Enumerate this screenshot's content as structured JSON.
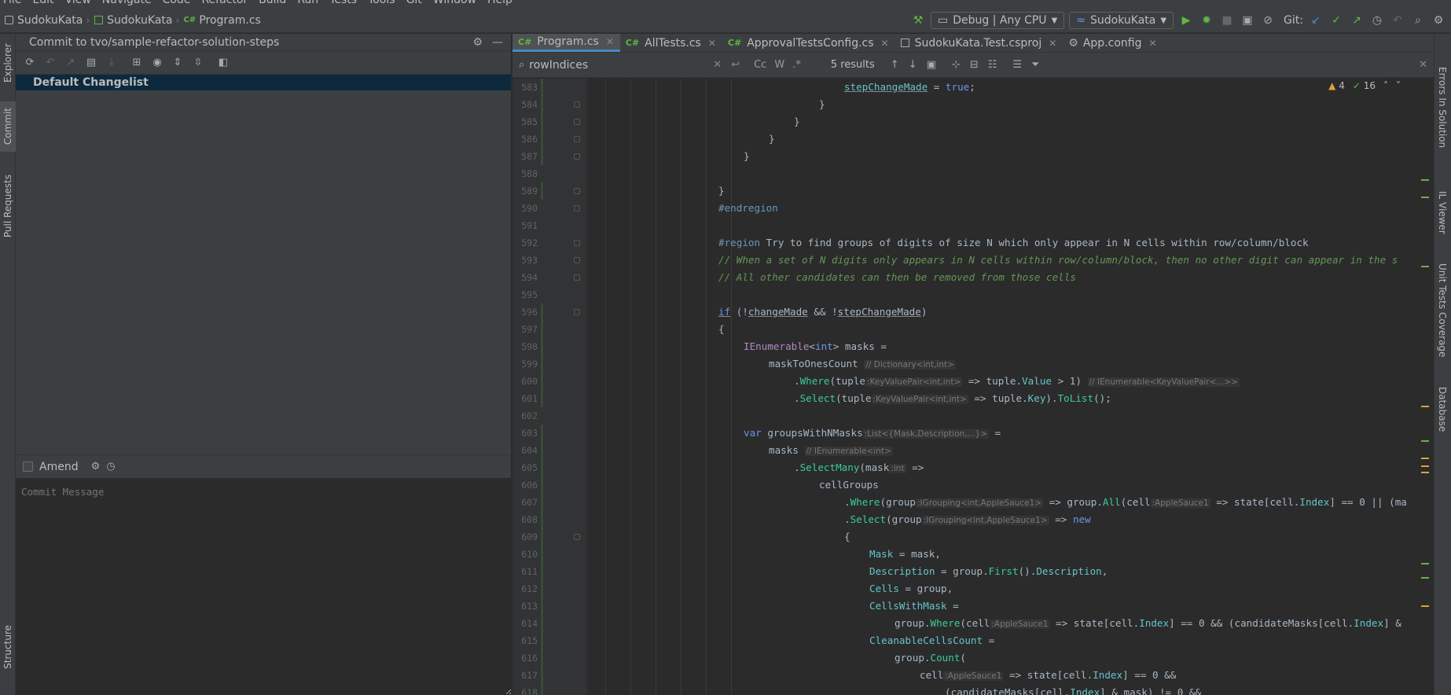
{
  "menu": [
    "File",
    "Edit",
    "View",
    "Navigate",
    "Code",
    "Refactor",
    "Build",
    "Run",
    "Tests",
    "Tools",
    "Git",
    "Window",
    "Help"
  ],
  "breadcrumb": [
    {
      "label": "SudokuKata",
      "icon": "solution-icon"
    },
    {
      "label": "SudokuKata",
      "icon": "project-icon"
    },
    {
      "label": "Program.cs",
      "icon": "csharp-icon"
    }
  ],
  "run_config": {
    "configuration": "Debug | Any CPU",
    "project": "SudokuKata",
    "git_label": "Git:"
  },
  "left_tools": {
    "explorer": "Explorer",
    "commit": "Commit",
    "pull_requests": "Pull Requests",
    "structure": "Structure"
  },
  "right_tools": {
    "errors": "Errors In Solution",
    "il_viewer": "IL Viewer",
    "coverage": "Unit Tests Coverage",
    "database": "Database"
  },
  "commit_panel": {
    "title": "Commit to tvo/sample-refactor-solution-steps",
    "changelist": "Default Changelist",
    "amend_label": "Amend",
    "commit_message_placeholder": "Commit Message"
  },
  "tabs": [
    {
      "label": "Program.cs",
      "icon": "csharp-icon",
      "active": true
    },
    {
      "label": "AllTests.cs",
      "icon": "csharp-icon",
      "active": false
    },
    {
      "label": "ApprovalTestsConfig.cs",
      "icon": "csharp-icon",
      "active": false
    },
    {
      "label": "SudokuKata.Test.csproj",
      "icon": "csproj-icon",
      "active": false
    },
    {
      "label": "App.config",
      "icon": "config-icon",
      "active": false
    }
  ],
  "search": {
    "query": "rowIndices",
    "results": "5 results",
    "opt_case": "Cc",
    "opt_word": "W",
    "opt_regex": ".*"
  },
  "inspection": {
    "warnings": "4",
    "ok": "16"
  },
  "code": {
    "lines": [
      "583",
      "584",
      "585",
      "586",
      "587",
      "588",
      "589",
      "590",
      "591",
      "592",
      "593",
      "594",
      "595",
      "596",
      "597",
      "598",
      "599",
      "600",
      "601",
      "602",
      "603",
      "604",
      "605",
      "606",
      "607",
      "608",
      "609",
      "610",
      "611",
      "612",
      "613",
      "614",
      "615",
      "616",
      "617",
      "618"
    ],
    "l583_a": "stepChangeMade",
    "l583_b": " = ",
    "l583_c": "true",
    "l583_d": ";",
    "brace_close": "}",
    "brace_open": "{",
    "l590": "#endregion",
    "l592_a": "#region",
    "l592_b": " Try to find groups of digits of size N which only appear in N cells within row/column/block",
    "l593": "// When a set of N digits only appears in N cells within row/column/block, then no other digit can appear in the s",
    "l594": "// All other candidates can then be removed from those cells",
    "l596_a": "if",
    "l596_b": " (!",
    "l596_c": "changeMade",
    "l596_d": " && !",
    "l596_e": "stepChangeMade",
    "l596_f": ")",
    "l598_a": "IEnumerable",
    "l598_b": "<",
    "l598_c": "int",
    "l598_d": "> masks =",
    "l599_a": "maskToOnesCount",
    "l599_h": "// Dictionary<int,int>",
    "l600_a": ".",
    "l600_b": "Where",
    "l600_c": "(tuple",
    "l600_h1": ":KeyValuePair<int,int>",
    "l600_d": " => tuple.",
    "l600_e": "Value",
    "l600_f": " > 1)",
    "l600_h2": "// IEnumerable<KeyValuePair<...>>",
    "l601_b": "Select",
    "l601_c": "(tuple",
    "l601_h1": ":KeyValuePair<int,int>",
    "l601_d": " => tuple.",
    "l601_e": "Key",
    "l601_f": ").",
    "l601_g": "ToList",
    "l601_i": "();",
    "l603_a": "var",
    "l603_b": " groupsWithNMasks",
    "l603_h": ":List<{Mask,Description,...}>",
    "l603_c": " =",
    "l604_a": "masks",
    "l604_h": "// IEnumerable<int>",
    "l605_b": "SelectMany",
    "l605_c": "(mask",
    "l605_h": ":int",
    "l605_d": " =>",
    "l606": "cellGroups",
    "l607_b": "Where",
    "l607_c": "(group",
    "l607_h1": ":IGrouping<int,AppleSauce1>",
    "l607_d": " => group.",
    "l607_e": "All",
    "l607_f": "(cell",
    "l607_h2": ":AppleSauce1",
    "l607_g": " => state[cell.",
    "l607_i": "Index",
    "l607_j": "] == 0 || (ma",
    "l608_b": "Select",
    "l608_c": "(group",
    "l608_h1": ":IGrouping<int,AppleSauce1>",
    "l608_d": " => ",
    "l608_e": "new",
    "l610_a": "Mask",
    "l610_b": " = mask,",
    "l611_a": "Description",
    "l611_b": " = group.",
    "l611_c": "First",
    "l611_d": "().",
    "l611_e": "Description",
    "l611_f": ",",
    "l612_a": "Cells",
    "l612_b": " = group,",
    "l613_a": "CellsWithMask",
    "l613_b": " =",
    "l614_a": "group.",
    "l614_b": "Where",
    "l614_c": "(cell",
    "l614_h": ":AppleSauce1",
    "l614_d": " => state[cell.",
    "l614_e": "Index",
    "l614_f": "] == 0 && (candidateMasks[cell.",
    "l614_g": "Index",
    "l614_i": "] &",
    "l615_a": "CleanableCellsCount",
    "l615_b": " =",
    "l616_a": "group.",
    "l616_b": "Count",
    "l616_c": "(",
    "l617_a": "cell",
    "l617_h": ":AppleSauce1",
    "l617_b": " => state[cell.",
    "l617_c": "Index",
    "l617_d": "] == 0 &&",
    "l618_a": "(candidateMasks[cell.",
    "l618_b": "Index",
    "l618_c": "] & mask) != 0 &&"
  }
}
